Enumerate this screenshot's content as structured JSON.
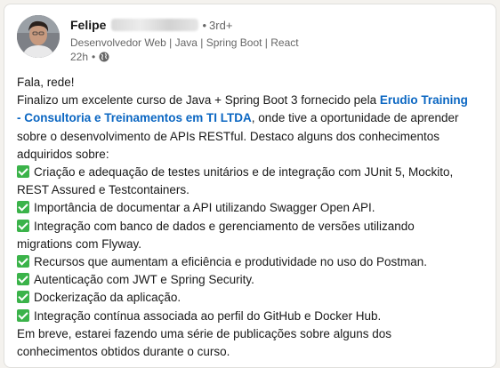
{
  "author": {
    "name": "Felipe",
    "separator": "•",
    "degree": "3rd+",
    "headline": "Desenvolvedor Web | Java | Spring Boot | React",
    "time": "22h",
    "time_separator": "•",
    "avatar_icon": "profile-photo",
    "visibility_icon": "globe-icon"
  },
  "post": {
    "greeting": "Fala, rede!",
    "intro_before_link": "Finalizo um excelente curso de Java + Spring Boot 3 fornecido pela ",
    "link_line1": "Erudio Training",
    "link_line2": "- Consultoria e Treinamentos em TI LTDA",
    "intro_after_link": ", onde tive a oportunidade de aprender",
    "intro_line3": "sobre o desenvolvimento de APIs RESTful. Destaco alguns dos conhecimentos",
    "intro_line4": "adquiridos sobre:",
    "items": [
      {
        "line1": "Criação e adequação de testes unitários e de integração com JUnit 5, Mockito,",
        "line2": "REST Assured e Testcontainers."
      },
      {
        "line1": "Importância de documentar a API utilizando Swagger Open API.",
        "line2": ""
      },
      {
        "line1": "Integração com banco de dados e gerenciamento de versões utilizando",
        "line2": "migrations com Flyway."
      },
      {
        "line1": "Recursos que aumentam a eficiência e produtividade no uso do Postman.",
        "line2": ""
      },
      {
        "line1": "Autenticação com JWT e Spring Security.",
        "line2": ""
      },
      {
        "line1": "Dockerização da aplicação.",
        "line2": ""
      },
      {
        "line1": "Integração contínua associada ao perfil do GitHub e Docker Hub.",
        "line2": ""
      }
    ],
    "closing_line1": "Em breve, estarei fazendo uma série de publicações sobre alguns dos",
    "closing_line2": "conhecimentos obtidos durante o curso.",
    "check_icon": "check-mark-button-emoji",
    "check_color": "#3bb34a",
    "link_color": "#0a66c2"
  }
}
